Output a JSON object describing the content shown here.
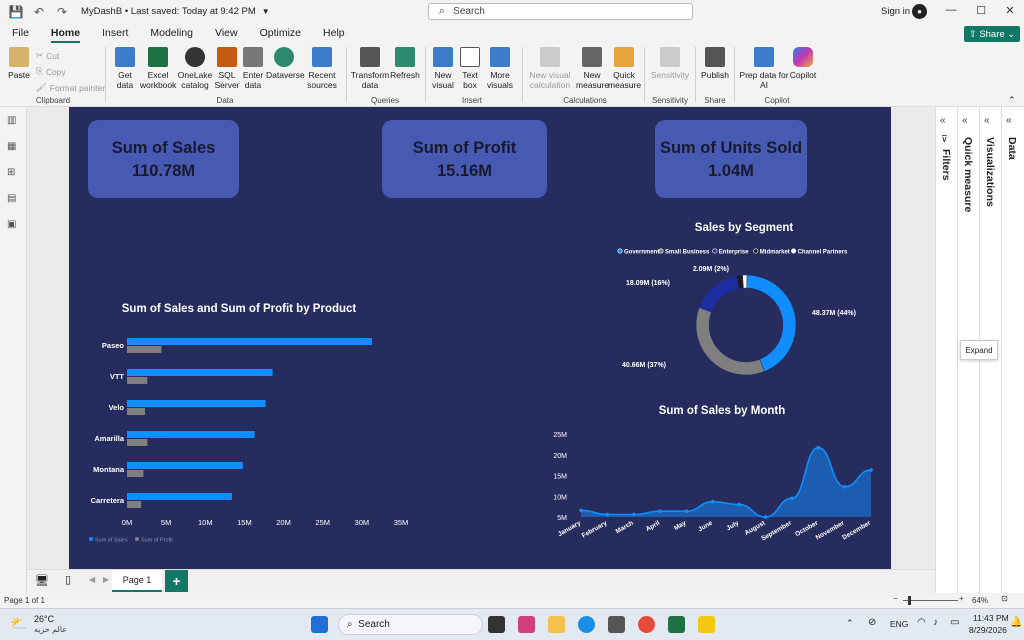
{
  "titlebar": {
    "doc_title": "MyDashB • Last saved: Today at 9:42 PM",
    "search_placeholder": "Search",
    "signin": "Sign in"
  },
  "menu": {
    "tabs": [
      "File",
      "Home",
      "Insert",
      "Modeling",
      "View",
      "Optimize",
      "Help"
    ],
    "active": "Home",
    "share": "Share"
  },
  "ribbon": {
    "clipboard": {
      "paste": "Paste",
      "cut": "Cut",
      "copy": "Copy",
      "format_painter": "Format painter",
      "group": "Clipboard"
    },
    "data": {
      "get_data": "Get data",
      "excel": "Excel workbook",
      "onelake": "OneLake catalog",
      "sql": "SQL Server",
      "enter": "Enter data",
      "dataverse": "Dataverse",
      "recent": "Recent sources",
      "group": "Data"
    },
    "queries": {
      "transform": "Transform data",
      "refresh": "Refresh",
      "group": "Queries"
    },
    "insert": {
      "new_visual": "New visual",
      "text_box": "Text box",
      "more_visuals": "More visuals",
      "group": "Insert"
    },
    "calculations": {
      "new_visual_calc": "New visual calculation",
      "new_measure": "New measure",
      "quick_measure": "Quick measure",
      "group": "Calculations"
    },
    "sensitivity": {
      "label": "Sensitivity",
      "group": "Sensitivity"
    },
    "share": {
      "publish": "Publish",
      "group": "Share"
    },
    "copilot": {
      "prep": "Prep data for AI",
      "copilot": "Copilot",
      "group": "Copilot"
    }
  },
  "cards": [
    {
      "label": "Sum of Sales",
      "value": "110.78M"
    },
    {
      "label": "Sum of Profit",
      "value": "15.16M"
    },
    {
      "label": "Sum of Units Sold",
      "value": "1.04M"
    }
  ],
  "chart_data": [
    {
      "type": "bar",
      "title": "Sum of Sales and Sum of Profit by Product",
      "orientation": "horizontal",
      "categories": [
        "Paseo",
        "VTT",
        "Velo",
        "Amarilla",
        "Montana",
        "Carretera"
      ],
      "series": [
        {
          "name": "Sum of Sales",
          "values": [
            31.3,
            18.6,
            17.7,
            16.3,
            14.8,
            13.4
          ],
          "color": "#118dff"
        },
        {
          "name": "Sum of Profit",
          "values": [
            4.4,
            2.6,
            2.3,
            2.6,
            2.1,
            1.8
          ],
          "color": "#7f7f7f"
        }
      ],
      "xticks": [
        "0M",
        "5M",
        "10M",
        "15M",
        "20M",
        "25M",
        "30M",
        "35M"
      ],
      "xlim": [
        0,
        35
      ],
      "legend": "bottom-left"
    },
    {
      "type": "pie",
      "title": "Sales by Segment",
      "donut": true,
      "categories": [
        "Government",
        "Small Business",
        "Enterprise",
        "Midmarket",
        "Channel Partners"
      ],
      "values": [
        48.37,
        40.66,
        18.09,
        2.09,
        1.57
      ],
      "colors": [
        "#118dff",
        "#7f7f7f",
        "#1c2ea2",
        "#1a1a1a",
        "#ffffff"
      ],
      "labels": [
        "48.37M (44%)",
        "40.66M (37%)",
        "18.09M (16%)",
        "2.09M (2%)",
        ""
      ],
      "legend": "top"
    },
    {
      "type": "area",
      "title": "Sum of Sales by Month",
      "categories": [
        "January",
        "February",
        "March",
        "April",
        "May",
        "June",
        "July",
        "August",
        "September",
        "October",
        "November",
        "December"
      ],
      "values": [
        6.6,
        5.6,
        5.6,
        6.4,
        6.4,
        8.7,
        8.0,
        5.0,
        9.5,
        21.7,
        12.3,
        16.3
      ],
      "yticks": [
        "5M",
        "10M",
        "15M",
        "20M",
        "25M"
      ],
      "ylim": [
        5,
        25
      ],
      "color": "#118dff"
    }
  ],
  "panes": {
    "filters": "Filters",
    "quick_measure": "Quick measure",
    "visualizations": "Visualizations",
    "data": "Data",
    "expand_tip": "Expand"
  },
  "pages": {
    "tab": "Page 1",
    "add": "+"
  },
  "status": {
    "page_info": "Page 1 of 1",
    "zoom": "64%"
  },
  "taskbar": {
    "weather_temp": "26°C",
    "weather_text": "عالم حزيه",
    "search": "Search",
    "lang": "ENG",
    "time": "11:43 PM",
    "date": "8/29/2026"
  }
}
